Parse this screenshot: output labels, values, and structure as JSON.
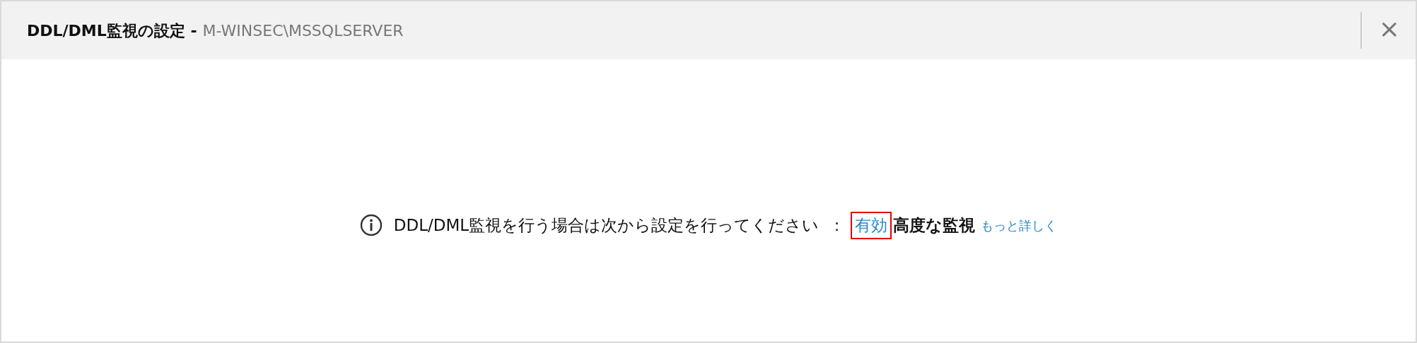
{
  "window": {
    "title": "DDL/DML監視の設定 -",
    "subtitle": "M-WINSEC\\MSSQLSERVER",
    "close": "×"
  },
  "message": {
    "text": "DDL/DML監視を行う場合は次から設定を行ってください",
    "separator": "：",
    "action_link": {
      "label": "有効",
      "highlighted": true
    },
    "feature": "高度な監視",
    "more_link": "もっと詳しく"
  }
}
